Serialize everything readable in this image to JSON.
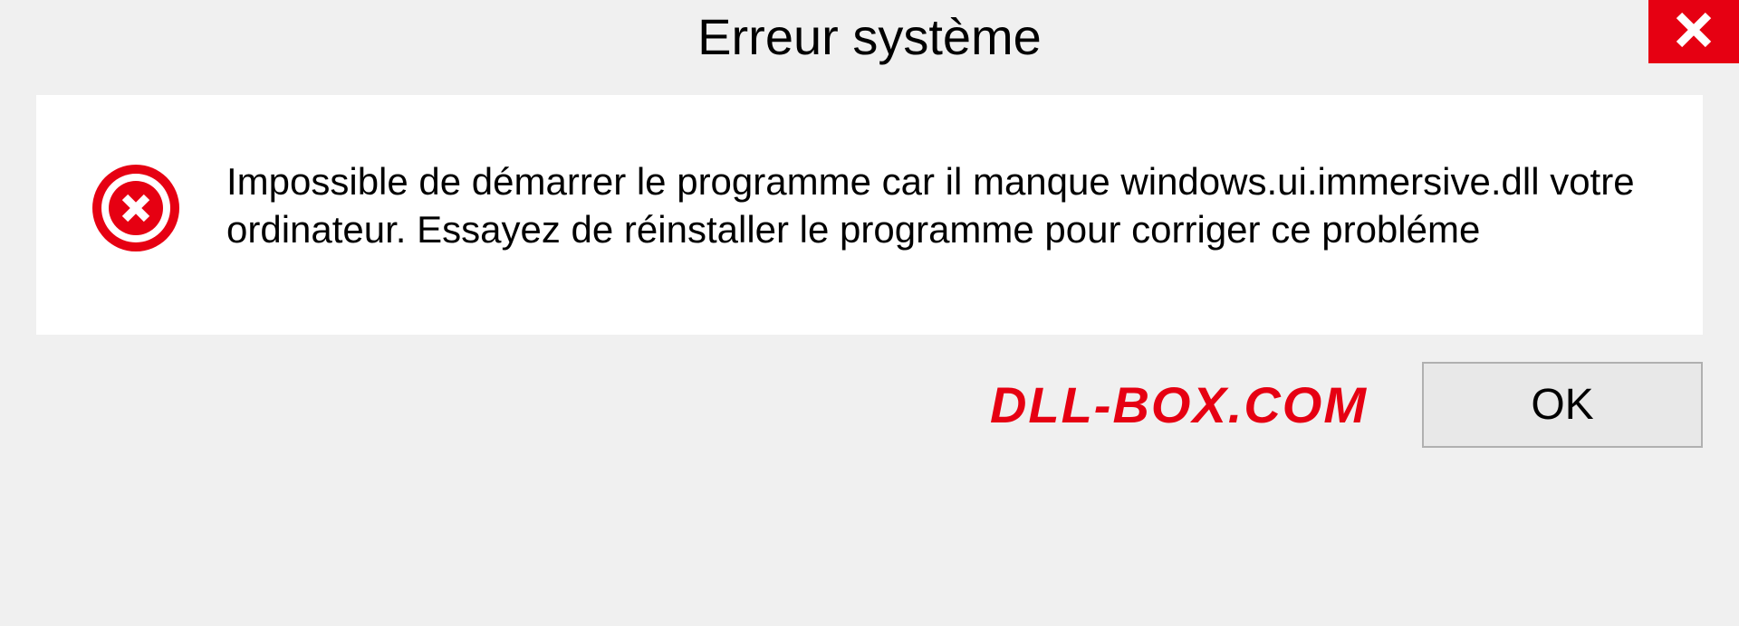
{
  "dialog": {
    "title": "Erreur système",
    "message": "Impossible de démarrer le programme car il manque windows.ui.immersive.dll votre ordinateur. Essayez de réinstaller le programme pour corriger ce probléme",
    "ok_label": "OK"
  },
  "watermark": "DLL-BOX.COM",
  "colors": {
    "error_red": "#e60012",
    "background": "#f0f0f0",
    "content_bg": "#ffffff"
  }
}
